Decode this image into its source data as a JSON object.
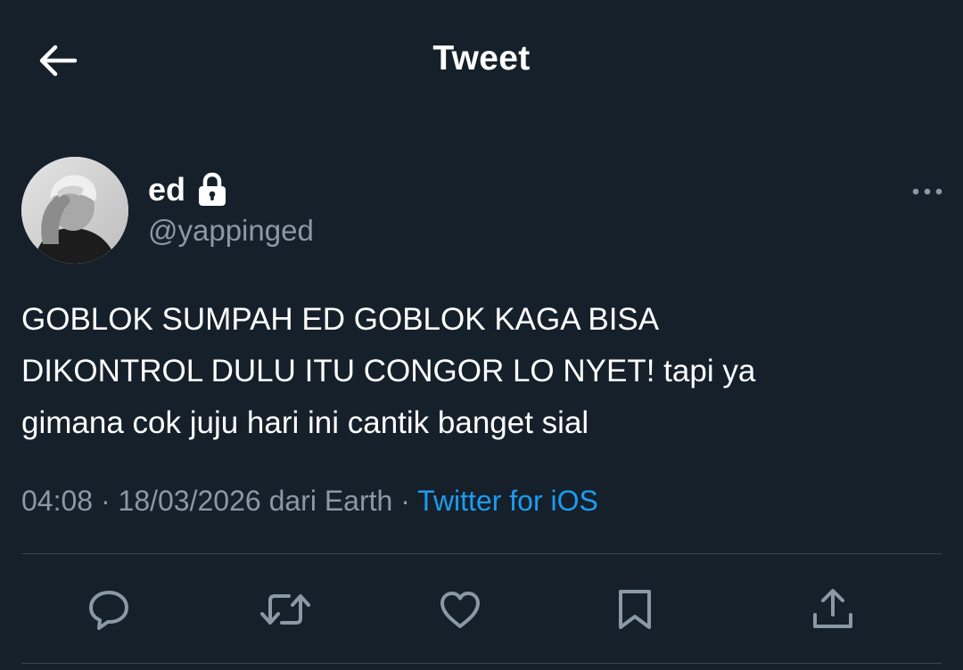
{
  "header": {
    "title": "Tweet",
    "back_icon": "arrow-left-icon"
  },
  "tweet": {
    "author": {
      "display_name": "ed",
      "handle": "@yappinged",
      "protected_icon": "lock-icon",
      "avatar": "avatar-photo"
    },
    "text": "GOBLOK SUMPAH ED GOBLOK KAGA BISA\nDIKONTROL DULU ITU CONGOR LO NYET! tapi ya\ngimana cok juju hari ini cantik banget sial",
    "time": "04:08",
    "separator": " · ",
    "date_location": "18/03/2026 dari Earth",
    "source": "Twitter for iOS"
  },
  "actions": [
    {
      "name": "reply",
      "icon": "reply-icon"
    },
    {
      "name": "retweet",
      "icon": "retweet-icon"
    },
    {
      "name": "like",
      "icon": "heart-icon"
    },
    {
      "name": "bookmark",
      "icon": "bookmark-icon"
    },
    {
      "name": "share",
      "icon": "share-icon"
    }
  ],
  "colors": {
    "background": "#15202b",
    "primary_text": "#ffffff",
    "secondary_text": "#8b98a5",
    "accent": "#1d9bf0",
    "divider": "#38444d"
  }
}
